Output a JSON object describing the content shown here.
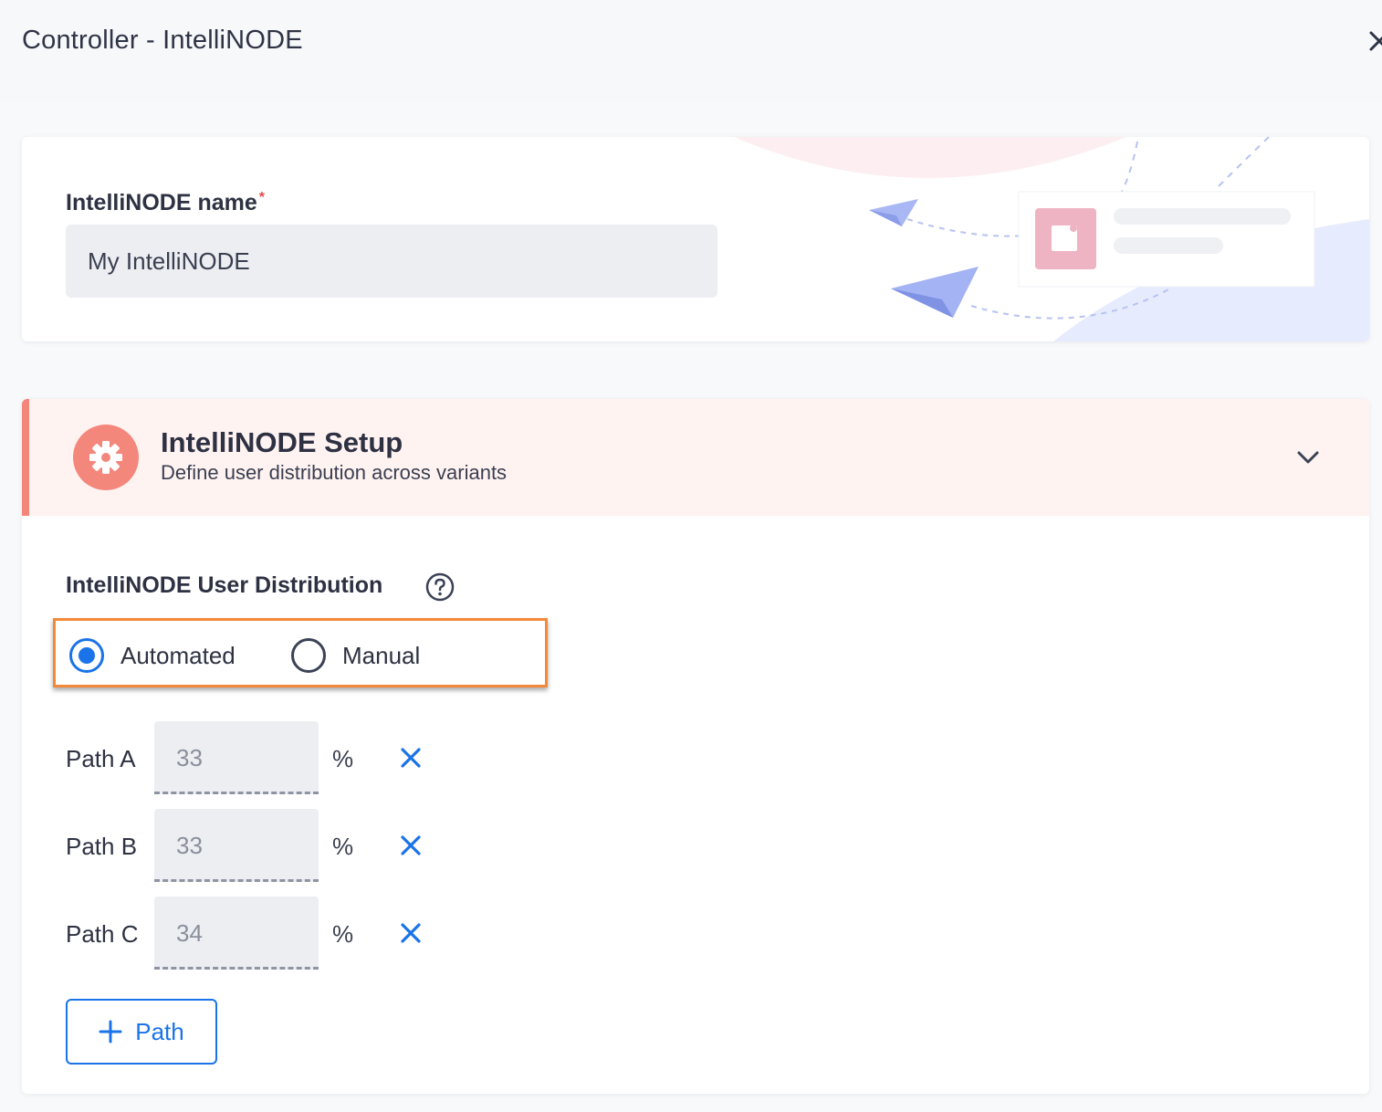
{
  "header": {
    "title": "Controller - IntelliNODE",
    "close_icon": "close-icon"
  },
  "name_section": {
    "label": "IntelliNODE name",
    "required_mark": "*",
    "value": "My IntelliNODE"
  },
  "setup": {
    "title": "IntelliNODE Setup",
    "subtitle": "Define user distribution across variants",
    "icon": "gear-icon",
    "expanded": true
  },
  "distribution": {
    "label": "IntelliNODE User Distribution",
    "help_icon": "question-circle-icon",
    "options": [
      {
        "label": "Automated",
        "checked": true
      },
      {
        "label": "Manual",
        "checked": false
      }
    ],
    "paths": [
      {
        "label": "Path A",
        "value": "33",
        "unit": "%"
      },
      {
        "label": "Path B",
        "value": "33",
        "unit": "%"
      },
      {
        "label": "Path C",
        "value": "34",
        "unit": "%"
      }
    ],
    "add_button_label": "Path"
  },
  "colors": {
    "primary": "#1a73e8",
    "accent": "#f4877c",
    "highlight": "#f28a3a"
  }
}
